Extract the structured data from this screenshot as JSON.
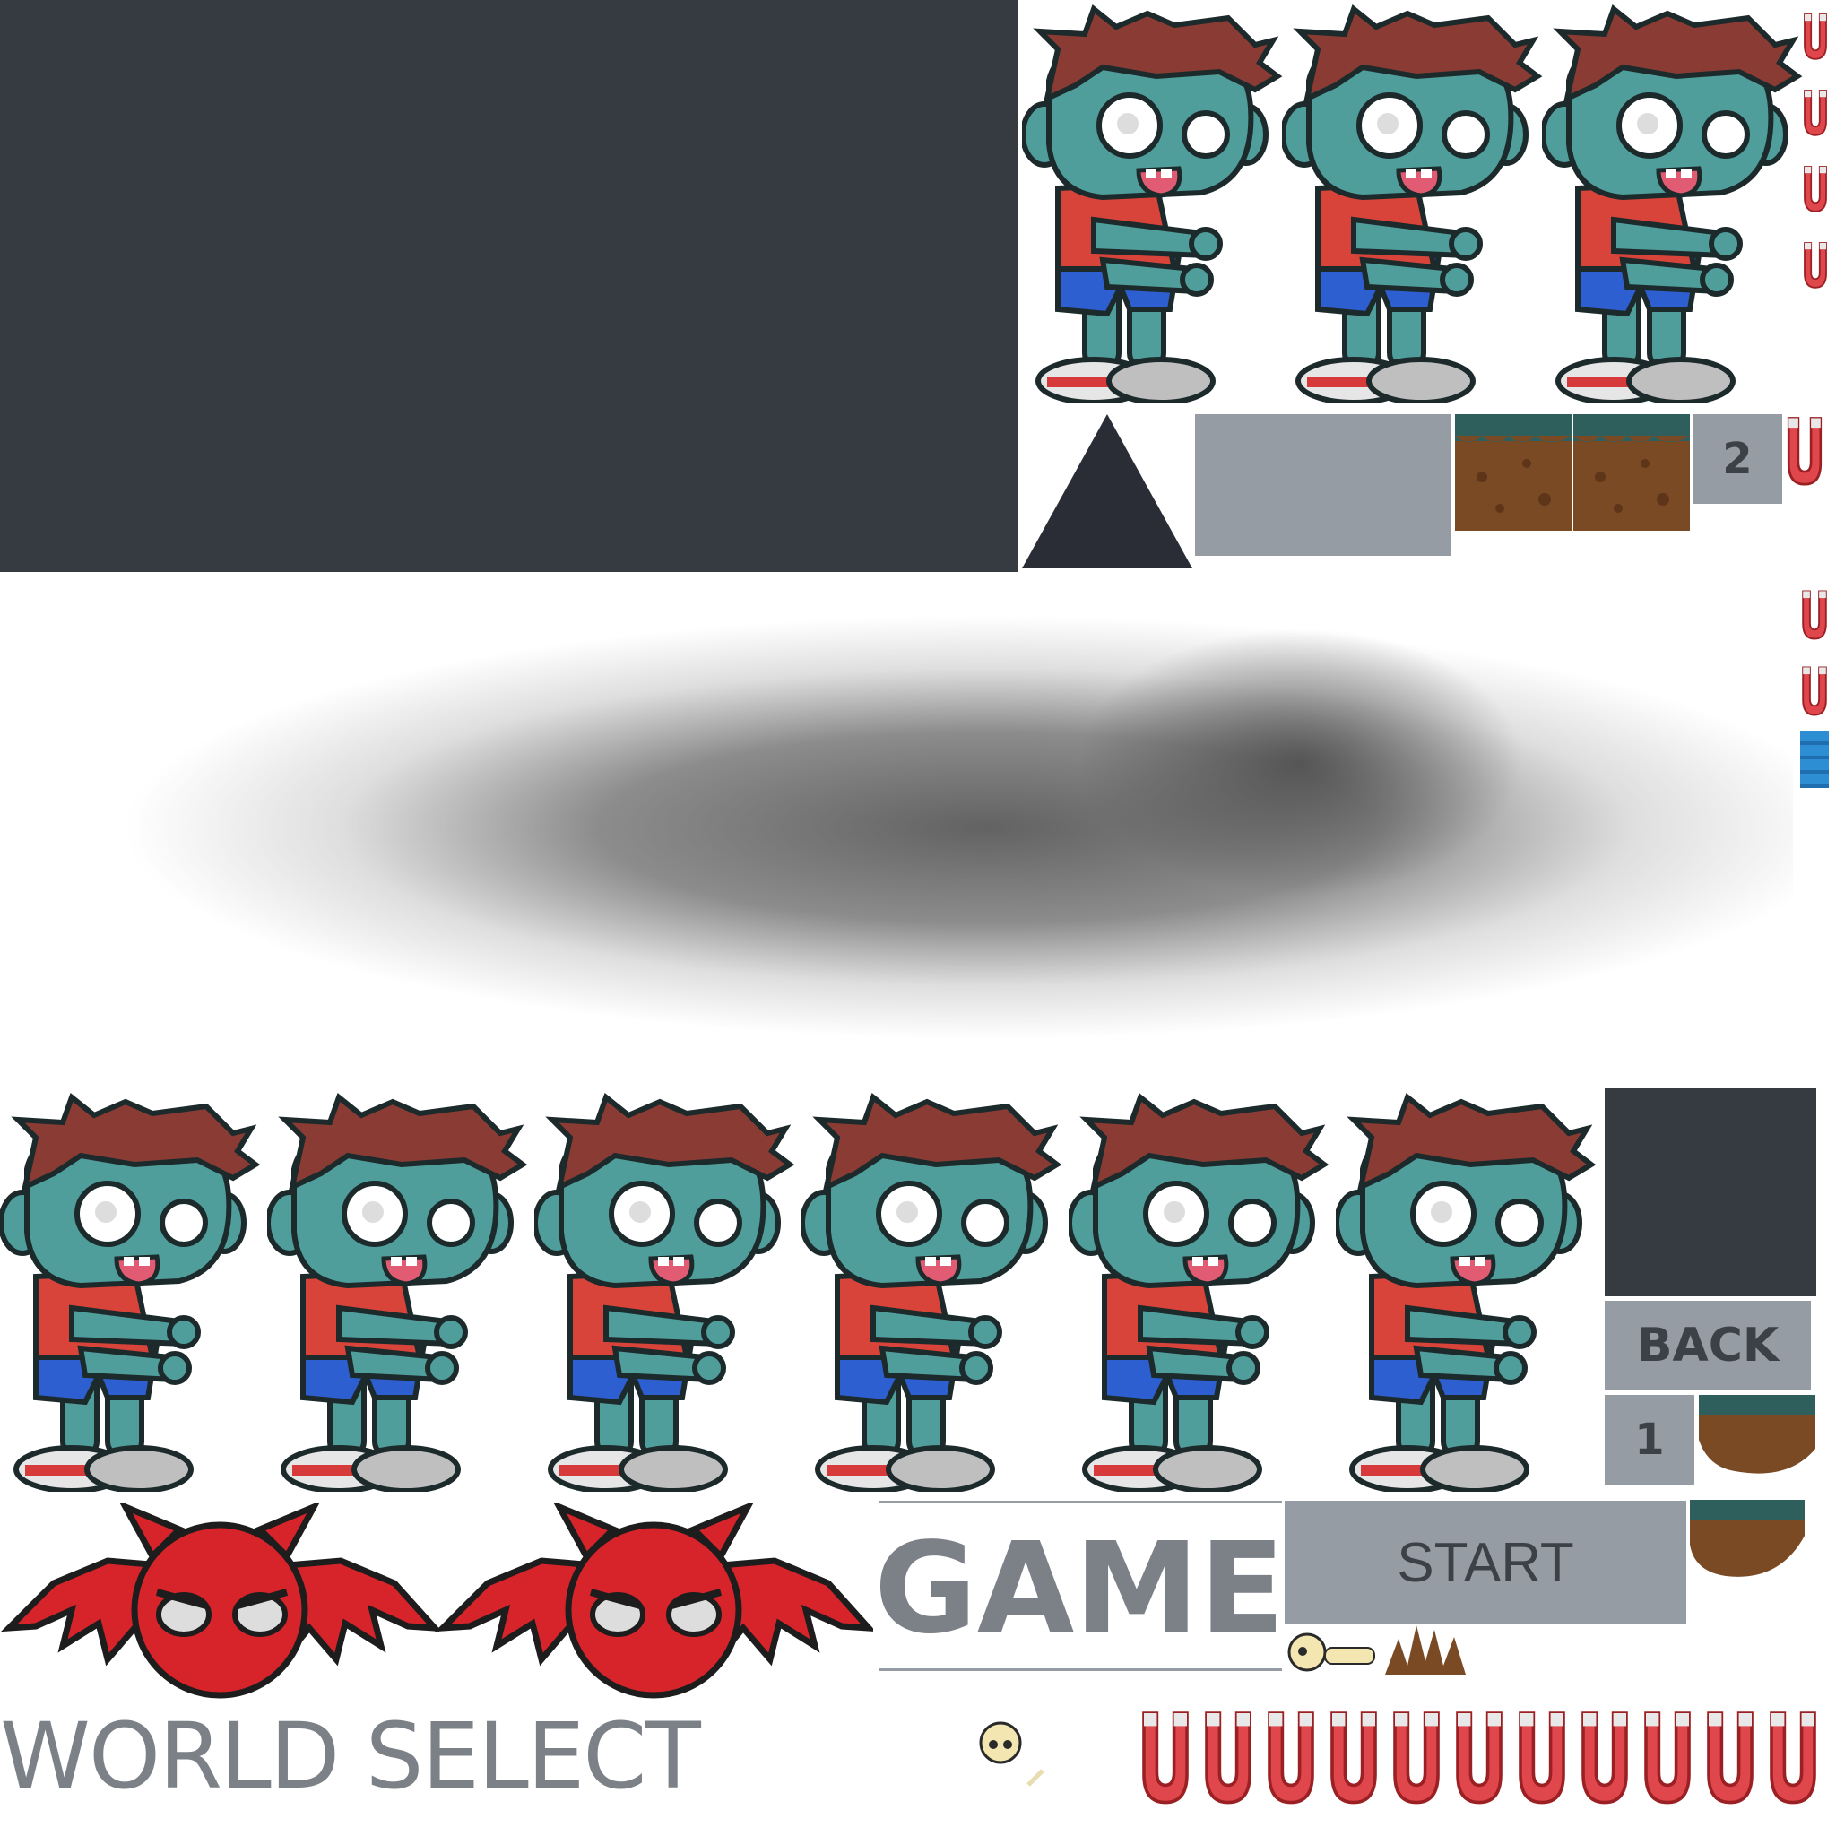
{
  "sheet": {
    "title": "GAME",
    "start_label": "START",
    "back_label": "BACK",
    "world_select_label": "WORLD SELECT",
    "level_labels": [
      "2",
      "1"
    ]
  },
  "sprites": {
    "zombie_count": 9,
    "bat_count": 2,
    "magnet_count": 11
  },
  "colors": {
    "panel_dark": "#363a41",
    "button_gray": "#969ca3",
    "text_dark": "#3c4047",
    "zombie_skin": "#4f9e9c",
    "zombie_hair": "#8a3c34",
    "zombie_shirt": "#d9443a",
    "bat_red": "#d6242a",
    "magnet_red": "#e0474c",
    "water_blue": "#2d8ed4",
    "dirt_brown": "#7a4a25",
    "grass_teal": "#2f5f5d"
  }
}
